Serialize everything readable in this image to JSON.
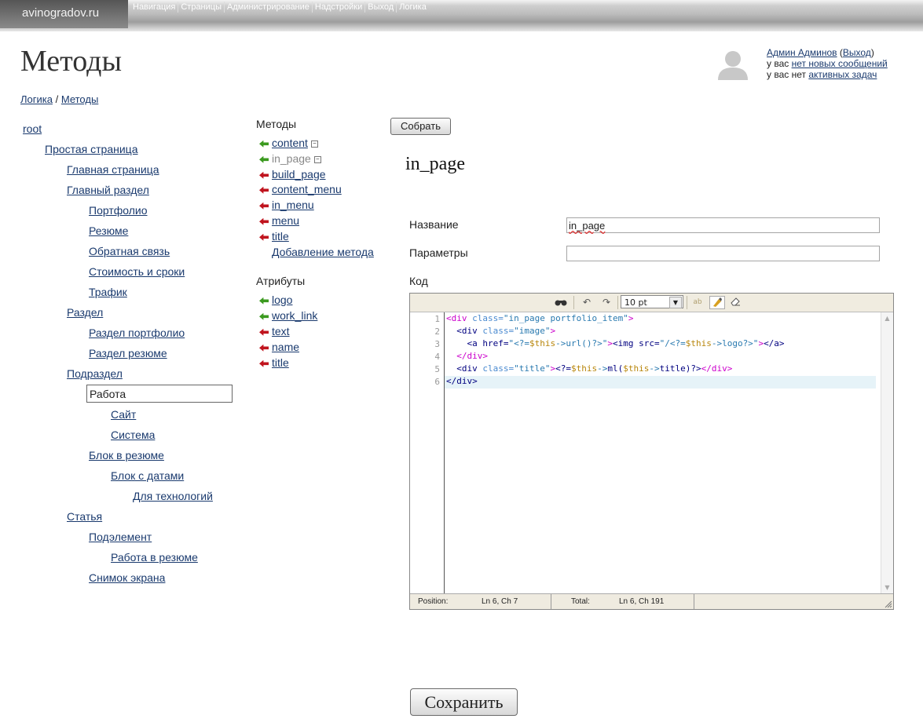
{
  "topbar": {
    "site": "avinogradov.ru",
    "nav": [
      "Навигация",
      "Страницы",
      "Администрирование",
      "Надстройки",
      "Выход",
      "Логика"
    ]
  },
  "page": {
    "title": "Методы"
  },
  "breadcrumb": {
    "parent": "Логика",
    "sep": "/",
    "current": "Методы"
  },
  "user": {
    "name": "Админ Админов",
    "logout": "Выход",
    "line2_prefix": "у вас",
    "messages_link": "нет новых сообщений",
    "line3_prefix": "у вас нет",
    "tasks_link": "активных задач"
  },
  "tree": {
    "items": [
      {
        "label": "root"
      },
      {
        "label": "Простая страница"
      },
      {
        "label": "Главная страница"
      },
      {
        "label": "Главный раздел"
      },
      {
        "label": "Портфолио"
      },
      {
        "label": "Резюме"
      },
      {
        "label": "Обратная связь"
      },
      {
        "label": "Стоимость и сроки"
      },
      {
        "label": "Трафик"
      },
      {
        "label": "Раздел"
      },
      {
        "label": "Раздел портфолио"
      },
      {
        "label": "Раздел резюме"
      },
      {
        "label": "Подраздел"
      },
      {
        "label": "Сайт"
      },
      {
        "label": "Система"
      },
      {
        "label": "Блок в резюме"
      },
      {
        "label": "Блок с датами"
      },
      {
        "label": "Для технологий"
      },
      {
        "label": "Статья"
      },
      {
        "label": "Подэлемент"
      },
      {
        "label": "Работа в резюме"
      },
      {
        "label": "Снимок экрана"
      }
    ],
    "selected": "Работа"
  },
  "methods": {
    "heading": "Методы",
    "items": [
      {
        "label": "content",
        "icon": "green-arrow-icon"
      },
      {
        "label": "in_page",
        "icon": "green-arrow-icon"
      },
      {
        "label": "build_page",
        "icon": "red-arrow-icon"
      },
      {
        "label": "content_menu",
        "icon": "red-arrow-icon"
      },
      {
        "label": "in_menu",
        "icon": "red-arrow-icon"
      },
      {
        "label": "menu",
        "icon": "red-arrow-icon"
      },
      {
        "label": "title",
        "icon": "red-arrow-icon"
      }
    ],
    "add_link": "Добавление метода",
    "collapse_glyph": "−"
  },
  "attributes": {
    "heading": "Атрибуты",
    "items": [
      {
        "label": "logo",
        "icon": "green-arrow-icon"
      },
      {
        "label": "work_link",
        "icon": "green-arrow-icon"
      },
      {
        "label": "text",
        "icon": "red-arrow-icon"
      },
      {
        "label": "name",
        "icon": "red-arrow-icon"
      },
      {
        "label": "title",
        "icon": "red-arrow-icon"
      }
    ]
  },
  "form": {
    "build_button": "Собрать",
    "method_title": "in_page",
    "name_label": "Название",
    "name_value": "in_page",
    "params_label": "Параметры",
    "params_value": "",
    "code_label": "Код",
    "save_button": "Сохранить"
  },
  "editor": {
    "font_size": "10 pt",
    "line_numbers": [
      "1",
      "2",
      "3",
      "4",
      "5",
      "6"
    ],
    "status": {
      "position_label": "Position:",
      "position_value": "Ln 6, Ch 7",
      "total_label": "Total:",
      "total_value": "Ln 6, Ch 191"
    },
    "code_lines": [
      [
        [
          "t-pink",
          "<div "
        ],
        [
          "t-attr",
          "class="
        ],
        [
          "t-str",
          "\"in_page portfolio_item\""
        ],
        [
          "t-pink",
          ">"
        ]
      ],
      [
        [
          "t-plain",
          "  "
        ],
        [
          "t-tag",
          "<div "
        ],
        [
          "t-attr",
          "class="
        ],
        [
          "t-str",
          "\"image\""
        ],
        [
          "t-pink",
          ">"
        ]
      ],
      [
        [
          "t-plain",
          "    "
        ],
        [
          "t-tag",
          "<a href="
        ],
        [
          "t-str",
          "\"<?="
        ],
        [
          "t-php",
          "$this"
        ],
        [
          "t-str",
          "->url()?>\""
        ],
        [
          "t-pink",
          ">"
        ],
        [
          "t-tag",
          "<img src="
        ],
        [
          "t-str",
          "\"/<?="
        ],
        [
          "t-php",
          "$this"
        ],
        [
          "t-str",
          "->logo?>\""
        ],
        [
          "t-pink",
          ">"
        ],
        [
          "t-tag",
          "</a>"
        ]
      ],
      [
        [
          "t-plain",
          "  "
        ],
        [
          "t-pink",
          "</div>"
        ]
      ],
      [
        [
          "t-plain",
          "  "
        ],
        [
          "t-tag",
          "<div "
        ],
        [
          "t-attr",
          "class="
        ],
        [
          "t-str",
          "\"title\""
        ],
        [
          "t-pink",
          ">"
        ],
        [
          "t-tag",
          "<?="
        ],
        [
          "t-php",
          "$this"
        ],
        [
          "t-str",
          "->"
        ],
        [
          "t-tag",
          "ml("
        ],
        [
          "t-php",
          "$this"
        ],
        [
          "t-str",
          "->"
        ],
        [
          "t-tag",
          "title)?>"
        ],
        [
          "t-pink",
          "</div>"
        ]
      ],
      [
        [
          "t-tag",
          "</div>"
        ]
      ]
    ]
  }
}
